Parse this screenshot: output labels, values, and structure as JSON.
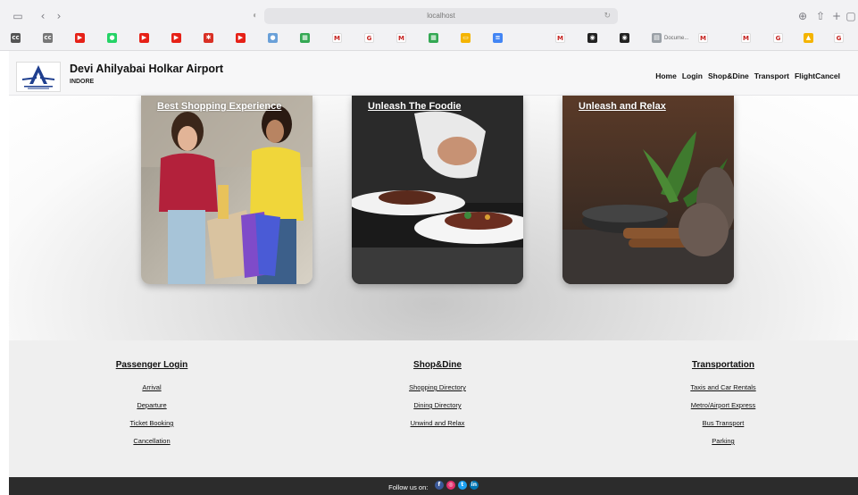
{
  "browser": {
    "url": "localhost",
    "bookmarks": [
      {
        "icon": "cc-icon",
        "color": "#555555",
        "glyph": "cc",
        "label": ""
      },
      {
        "icon": "cc-icon",
        "color": "#777777",
        "glyph": "cc",
        "label": ""
      },
      {
        "icon": "youtube-icon",
        "color": "#e62117",
        "glyph": "▶",
        "label": ""
      },
      {
        "icon": "whatsapp-icon",
        "color": "#25d366",
        "glyph": "●",
        "label": ""
      },
      {
        "icon": "youtube-icon",
        "color": "#e62117",
        "glyph": "▶",
        "label": ""
      },
      {
        "icon": "youtube-icon",
        "color": "#e62117",
        "glyph": "▶",
        "label": ""
      },
      {
        "icon": "gear-icon",
        "color": "#d93025",
        "glyph": "✱",
        "label": ""
      },
      {
        "icon": "youtube-icon",
        "color": "#e62117",
        "glyph": "▶",
        "label": ""
      },
      {
        "icon": "dot-icon",
        "color": "#6aa0d8",
        "glyph": "●",
        "label": ""
      },
      {
        "icon": "sheets-icon",
        "color": "#34a853",
        "glyph": "▦",
        "label": ""
      },
      {
        "icon": "gmail-icon",
        "color": "#ffffff",
        "glyph": "M",
        "label": ""
      },
      {
        "icon": "google-icon",
        "color": "#ffffff",
        "glyph": "G",
        "label": ""
      },
      {
        "icon": "gmail-icon",
        "color": "#ffffff",
        "glyph": "M",
        "label": ""
      },
      {
        "icon": "sheets-icon",
        "color": "#34a853",
        "glyph": "▦",
        "label": ""
      },
      {
        "icon": "slides-icon",
        "color": "#f4b400",
        "glyph": "▭",
        "label": ""
      },
      {
        "icon": "docs-icon",
        "color": "#4285f4",
        "glyph": "≡",
        "label": ""
      },
      {
        "icon": "gmail-icon",
        "color": "#ffffff",
        "glyph": "M",
        "label": ""
      },
      {
        "icon": "github-icon",
        "color": "#222222",
        "glyph": "◉",
        "label": ""
      },
      {
        "icon": "github-icon",
        "color": "#222222",
        "glyph": "◉",
        "label": ""
      },
      {
        "icon": "document-icon",
        "color": "#9aa0a6",
        "glyph": "▤",
        "label": "Docume..."
      },
      {
        "icon": "gmail-icon",
        "color": "#ffffff",
        "glyph": "M",
        "label": ""
      },
      {
        "icon": "gmail-icon",
        "color": "#ffffff",
        "glyph": "M",
        "label": ""
      },
      {
        "icon": "google-icon",
        "color": "#ffffff",
        "glyph": "G",
        "label": ""
      },
      {
        "icon": "drive-icon",
        "color": "#f4b400",
        "glyph": "▲",
        "label": ""
      },
      {
        "icon": "google-icon",
        "color": "#ffffff",
        "glyph": "G",
        "label": ""
      }
    ]
  },
  "header": {
    "title": "Devi Ahilyabai Holkar Airport",
    "subtitle": "INDORE",
    "nav": [
      "Home",
      "Login",
      "Shop&Dine",
      "Transport",
      "FlightCancel"
    ]
  },
  "cards": [
    {
      "title": "Best Shopping Experience"
    },
    {
      "title": "Unleash The Foodie"
    },
    {
      "title": "Unleash and Relax"
    }
  ],
  "footer": {
    "columns": [
      {
        "title": "Passenger Login",
        "items": [
          "Arrival",
          "Departure",
          "Ticket Booking",
          "Cancellation"
        ]
      },
      {
        "title": "Shop&Dine",
        "items": [
          "Shopping Directory",
          "Dining Directory",
          "Unwind and Relax"
        ]
      },
      {
        "title": "Transportation",
        "items": [
          "Taxis and Car Rentals",
          "Metro/Airport Express",
          "Bus Transport",
          "Parking"
        ]
      }
    ],
    "follow_label": "Follow us on:",
    "social": [
      {
        "icon": "facebook-icon",
        "color": "#3b5998",
        "glyph": "f"
      },
      {
        "icon": "instagram-icon",
        "color": "#e1306c",
        "glyph": "◎"
      },
      {
        "icon": "twitter-icon",
        "color": "#1da1f2",
        "glyph": "t"
      },
      {
        "icon": "linkedin-icon",
        "color": "#0077b5",
        "glyph": "in"
      }
    ]
  }
}
